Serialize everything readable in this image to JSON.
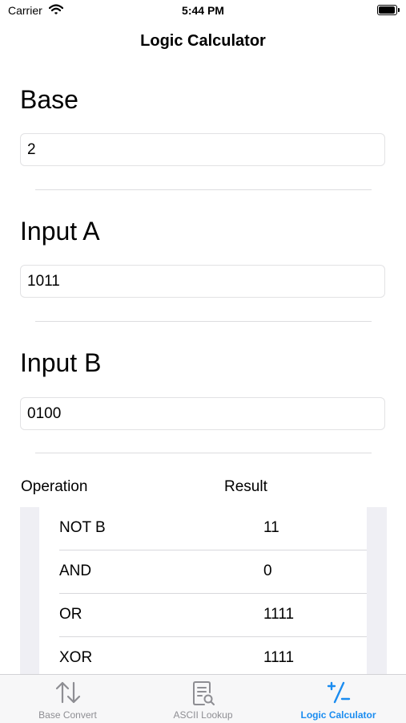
{
  "status_bar": {
    "carrier": "Carrier",
    "time": "5:44 PM"
  },
  "nav": {
    "title": "Logic Calculator"
  },
  "base": {
    "title": "Base",
    "value": "2"
  },
  "input_a": {
    "title": "Input A",
    "value": "1011"
  },
  "input_b": {
    "title": "Input B",
    "value": "0100"
  },
  "results": {
    "headers": {
      "operation": "Operation",
      "result": "Result"
    },
    "rows": [
      {
        "operation": "NOT B",
        "result": "11"
      },
      {
        "operation": "AND",
        "result": "0"
      },
      {
        "operation": "OR",
        "result": "1111"
      },
      {
        "operation": "XOR",
        "result": "1111"
      }
    ]
  },
  "tab_bar": {
    "tabs": [
      {
        "label": "Base Convert",
        "icon": "arrows-up-down-icon",
        "active": false
      },
      {
        "label": "ASCII Lookup",
        "icon": "document-search-icon",
        "active": false
      },
      {
        "label": "Logic Calculator",
        "icon": "plus-slash-minus-icon",
        "active": true
      }
    ],
    "active_color": "#1a8cf0",
    "inactive_color": "#8e8e93"
  }
}
